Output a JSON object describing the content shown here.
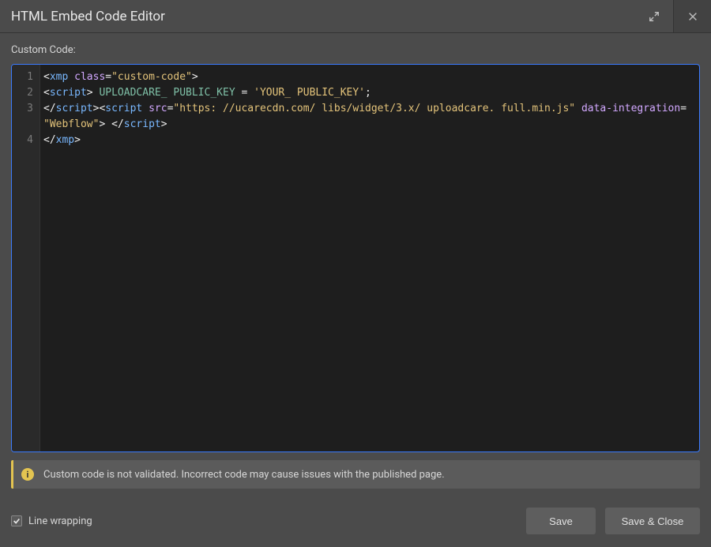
{
  "header": {
    "title": "HTML Embed Code Editor"
  },
  "label": "Custom Code:",
  "code": {
    "line_numbers": [
      "1",
      "2",
      "3",
      "",
      "4"
    ],
    "tokens": [
      [
        {
          "t": "<",
          "c": "bracket"
        },
        {
          "t": "xmp ",
          "c": "tag"
        },
        {
          "t": "class",
          "c": "attr"
        },
        {
          "t": "=",
          "c": "op"
        },
        {
          "t": "\"custom-code\"",
          "c": "string"
        },
        {
          "t": ">",
          "c": "bracket"
        }
      ],
      [
        {
          "t": "<",
          "c": "bracket"
        },
        {
          "t": "script",
          "c": "tag"
        },
        {
          "t": "> ",
          "c": "bracket"
        },
        {
          "t": "UPLOADCARE_ PUBLIC_KEY",
          "c": "ident"
        },
        {
          "t": " = ",
          "c": "op"
        },
        {
          "t": "'YOUR_ PUBLIC_KEY'",
          "c": "string"
        },
        {
          "t": ";",
          "c": "op"
        }
      ],
      [
        {
          "t": "<",
          "c": "bracket"
        },
        {
          "t": "/",
          "c": "bracket"
        },
        {
          "t": "script",
          "c": "tag"
        },
        {
          "t": ">",
          "c": "bracket"
        },
        {
          "t": "<",
          "c": "bracket"
        },
        {
          "t": "script ",
          "c": "tag"
        },
        {
          "t": "src",
          "c": "attr"
        },
        {
          "t": "=",
          "c": "op"
        },
        {
          "t": "\"https: //ucarecdn.com/ libs/widget/3.x/ uploadcare. full.min.js\"",
          "c": "string"
        },
        {
          "t": " ",
          "c": "op"
        },
        {
          "t": "data-integration",
          "c": "attr"
        },
        {
          "t": "= ",
          "c": "op"
        },
        {
          "t": "\"Webflow\"",
          "c": "string"
        },
        {
          "t": "> ",
          "c": "bracket"
        },
        {
          "t": "<",
          "c": "bracket"
        },
        {
          "t": "/",
          "c": "bracket"
        },
        {
          "t": "script",
          "c": "tag"
        },
        {
          "t": ">",
          "c": "bracket"
        }
      ],
      [
        {
          "t": "<",
          "c": "bracket"
        },
        {
          "t": "/",
          "c": "bracket"
        },
        {
          "t": "xmp",
          "c": "tag"
        },
        {
          "t": ">",
          "c": "bracket"
        }
      ]
    ]
  },
  "warning": {
    "icon_label": "i",
    "text": "Custom code is not validated. Incorrect code may cause issues with the published page."
  },
  "footer": {
    "line_wrapping_label": "Line wrapping",
    "line_wrapping_checked": true,
    "save_label": "Save",
    "save_close_label": "Save & Close"
  }
}
